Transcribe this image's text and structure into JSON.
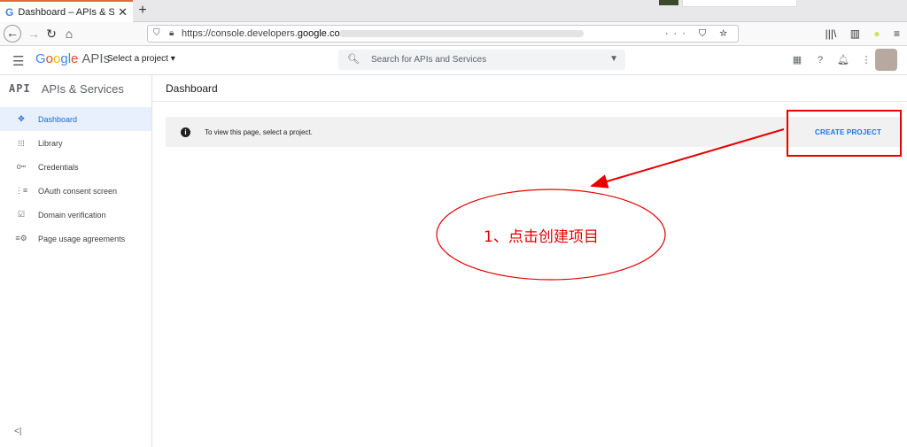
{
  "browser": {
    "tab_title": "Dashboard – APIs & Servi",
    "tab_favicon": "G",
    "close_glyph": "✕",
    "new_tab_glyph": "+",
    "url_prefix": "https://console.developers.",
    "url_domain": "google.com",
    "url_actions": "··· ⛉ ☆"
  },
  "appbar": {
    "logo_google": [
      "G",
      "o",
      "o",
      "g",
      "l",
      "e"
    ],
    "logo_apis": "APIs",
    "project_selector": "Select a project ▾",
    "search_placeholder": "Search for APIs and Services",
    "search_icon": "search-icon",
    "icons": [
      "gift-icon",
      "help-icon",
      "notifications-icon",
      "more-vert-icon"
    ]
  },
  "sidebar": {
    "logo": "API",
    "title": "APIs & Services",
    "items": [
      {
        "label": "Dashboard",
        "icon": "dashboard-icon",
        "glyph": "✥",
        "active": true
      },
      {
        "label": "Library",
        "icon": "library-icon",
        "glyph": "⁞⁞⁞",
        "active": false
      },
      {
        "label": "Credentials",
        "icon": "key-icon",
        "glyph": "o┅",
        "active": false
      },
      {
        "label": "OAuth consent screen",
        "icon": "consent-icon",
        "glyph": "⋮≡",
        "active": false
      },
      {
        "label": "Domain verification",
        "icon": "checkbox-icon",
        "glyph": "☑",
        "active": false
      },
      {
        "label": "Page usage agreements",
        "icon": "settings-list-icon",
        "glyph": "≡⚙",
        "active": false
      }
    ],
    "collapse": "<|"
  },
  "main": {
    "title": "Dashboard",
    "info_icon": "i",
    "info_text": "To view this page, select a project.",
    "create_button": "CREATE PROJECT"
  },
  "annotation": {
    "text": "1、点击创建项目",
    "color": "#e60000"
  },
  "colors": {
    "accent": "#1a73e8",
    "active_bg": "#e8f0fe",
    "annotation_red": "#e60000"
  }
}
